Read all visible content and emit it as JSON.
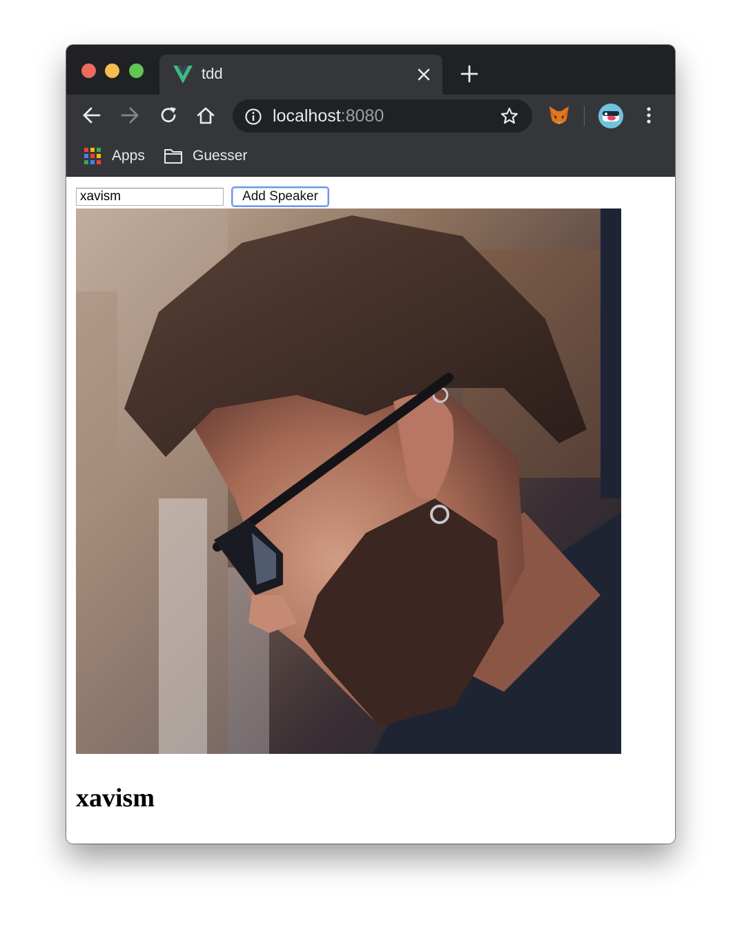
{
  "browser": {
    "tab": {
      "title": "tdd",
      "favicon": "vue-logo-icon"
    },
    "address_bar": {
      "host": "localhost",
      "port": ":8080"
    },
    "bookmarks": [
      {
        "label": "Apps",
        "icon": "apps-grid-icon"
      },
      {
        "label": "Guesser",
        "icon": "folder-icon"
      }
    ],
    "extensions": [
      "metamask-fox-icon"
    ],
    "colors": {
      "chrome_dark": "#202124",
      "chrome_toolbar": "#35363a",
      "text_light": "#e8eaed",
      "text_dim": "#9aa0a6",
      "vue_green": "#41b883",
      "button_focus_ring": "#6a98e8"
    }
  },
  "page": {
    "speaker_input": {
      "value": "xavism"
    },
    "add_button_label": "Add Speaker",
    "speaker": {
      "name": "xavism",
      "photo": "speaker-portrait"
    }
  }
}
